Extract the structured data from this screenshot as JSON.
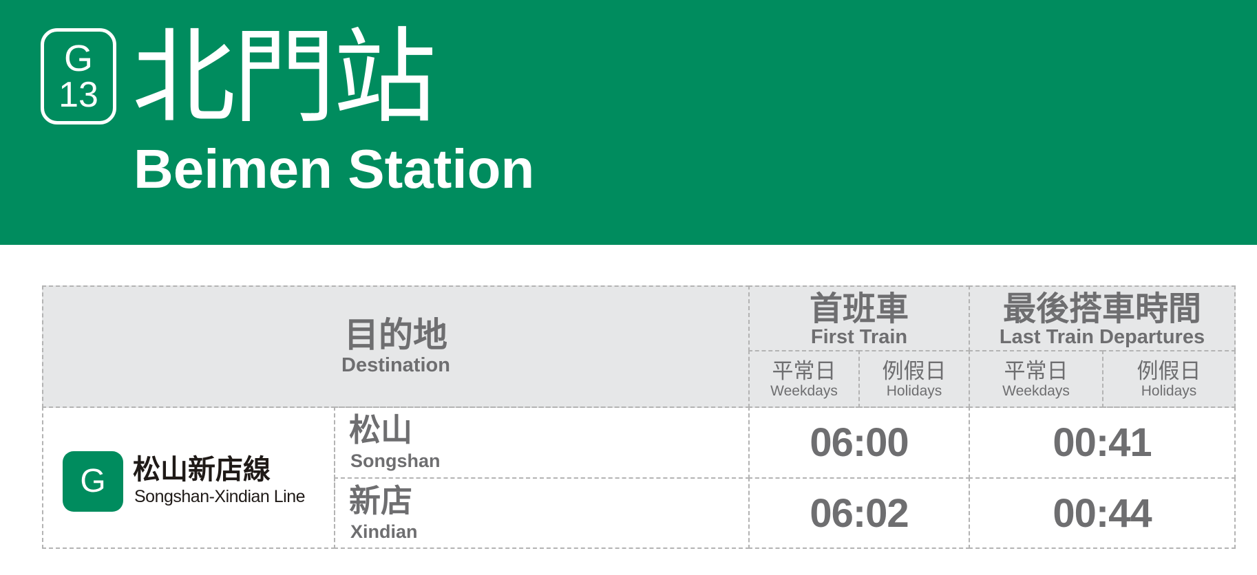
{
  "station": {
    "line_code": "G",
    "station_number": "13",
    "name_zh": "北門站",
    "name_en": "Beimen Station"
  },
  "colors": {
    "line_green": "#008c5e",
    "header_bg": "#e6e7e8",
    "text_gray": "#6e6e70"
  },
  "table": {
    "headers": {
      "destination_zh": "目的地",
      "destination_en": "Destination",
      "first_train_zh": "首班車",
      "first_train_en": "First Train",
      "last_train_zh": "最後搭車時間",
      "last_train_en": "Last Train Departures",
      "weekdays_zh": "平常日",
      "weekdays_en": "Weekdays",
      "holidays_zh": "例假日",
      "holidays_en": "Holidays"
    },
    "line": {
      "icon_letter": "G",
      "name_zh": "松山新店線",
      "name_en": "Songshan-Xindian Line"
    },
    "rows": [
      {
        "destination_zh": "松山",
        "destination_en": "Songshan",
        "first_train": "06:00",
        "last_train": "00:41"
      },
      {
        "destination_zh": "新店",
        "destination_en": "Xindian",
        "first_train": "06:02",
        "last_train": "00:44"
      }
    ]
  }
}
